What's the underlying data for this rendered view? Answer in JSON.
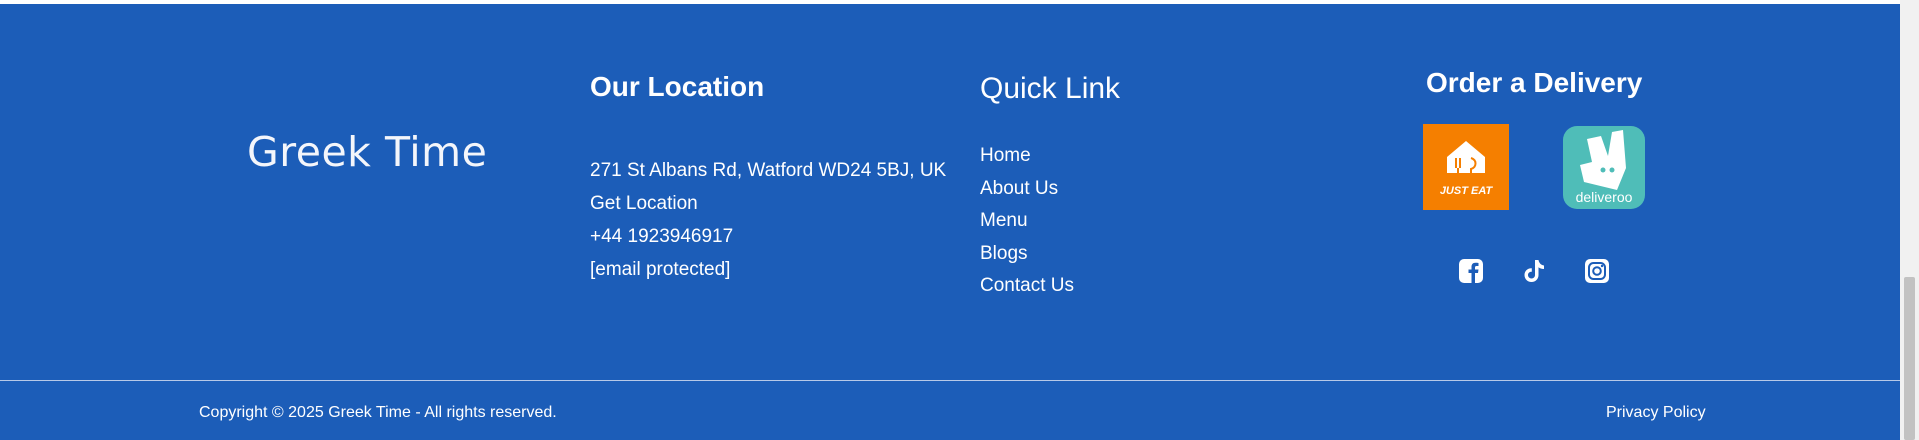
{
  "brand": {
    "name": "Greek Time"
  },
  "location": {
    "title": "Our Location",
    "address": "271 St Albans Rd, Watford WD24 5BJ, UK",
    "get_location": "Get Location",
    "phone": "+44 1923946917",
    "email": "[email protected]"
  },
  "quick_links": {
    "title": "Quick Link",
    "items": [
      "Home",
      "About Us",
      "Menu",
      "Blogs",
      "Contact Us"
    ]
  },
  "delivery": {
    "title": "Order a Delivery",
    "just_eat_label": "JUST EAT",
    "deliveroo_label": "deliveroo"
  },
  "social": {
    "icons": [
      "facebook-icon",
      "tiktok-icon",
      "instagram-icon"
    ]
  },
  "bottom_bar": {
    "copyright": "Copyright © 2025 Greek Time - All rights reserved.",
    "privacy": "Privacy Policy"
  },
  "colors": {
    "footer_bg": "#1c5db8",
    "just_eat": "#f57f00",
    "deliveroo": "#4fbdb8"
  }
}
